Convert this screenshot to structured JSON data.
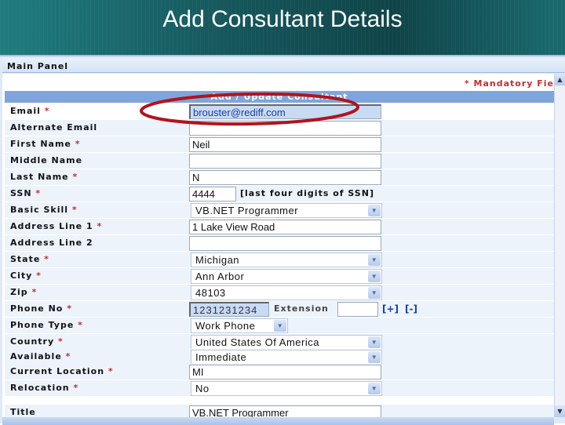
{
  "slide_title": "Add Consultant Details",
  "panel": {
    "title": "Main Panel",
    "mandatory_note": "* Mandatory Fie",
    "form_title": "Add / Update Consultant"
  },
  "fields": [
    {
      "label": "Email",
      "required": "*",
      "type": "input",
      "value": "brouster@rediff.com"
    },
    {
      "label": "Alternate Email",
      "required": "",
      "type": "input",
      "value": ""
    },
    {
      "label": "First Name",
      "required": "*",
      "type": "input",
      "value": "Neil"
    },
    {
      "label": "Middle Name",
      "required": "",
      "type": "input",
      "value": ""
    },
    {
      "label": "Last Name",
      "required": "*",
      "type": "input",
      "value": "N"
    },
    {
      "label": "SSN",
      "required": "*",
      "type": "ssn",
      "value": "4444",
      "hint": "[last four digits of SSN]"
    },
    {
      "label": "Basic Skill",
      "required": "*",
      "type": "select",
      "value": "VB.NET Programmer"
    },
    {
      "label": "Address Line 1",
      "required": "*",
      "type": "input",
      "value": "1 Lake View Road"
    },
    {
      "label": "Address Line 2",
      "required": "",
      "type": "input",
      "value": ""
    },
    {
      "label": "State",
      "required": "*",
      "type": "select",
      "value": "Michigan"
    },
    {
      "label": "City",
      "required": "*",
      "type": "select",
      "value": "Ann Arbor"
    },
    {
      "label": "Zip",
      "required": "*",
      "type": "select",
      "value": "48103"
    },
    {
      "label": "Phone No",
      "required": "*",
      "type": "phone",
      "value": "1231231234",
      "ext_label": "Extension",
      "ext_value": "",
      "add_link": "[+]",
      "remove_link": "[-]"
    },
    {
      "label": "Phone Type",
      "required": "*",
      "type": "small-select",
      "value": "Work Phone"
    },
    {
      "label": "Country",
      "required": "*",
      "type": "select",
      "value": "United States Of America"
    },
    {
      "label": "Available",
      "required": "*",
      "type": "select",
      "value": "Immediate"
    },
    {
      "label": "Current Location",
      "required": "*",
      "type": "input",
      "value": "MI"
    },
    {
      "label": "Relocation",
      "required": "*",
      "type": "select",
      "value": "No"
    },
    {
      "label": "Title",
      "required": "",
      "type": "input",
      "value": "VB.NET Programmer"
    }
  ],
  "colors": {
    "annotation": "#b0141e",
    "header": "#7fa6dc",
    "required": "#c0302e"
  }
}
